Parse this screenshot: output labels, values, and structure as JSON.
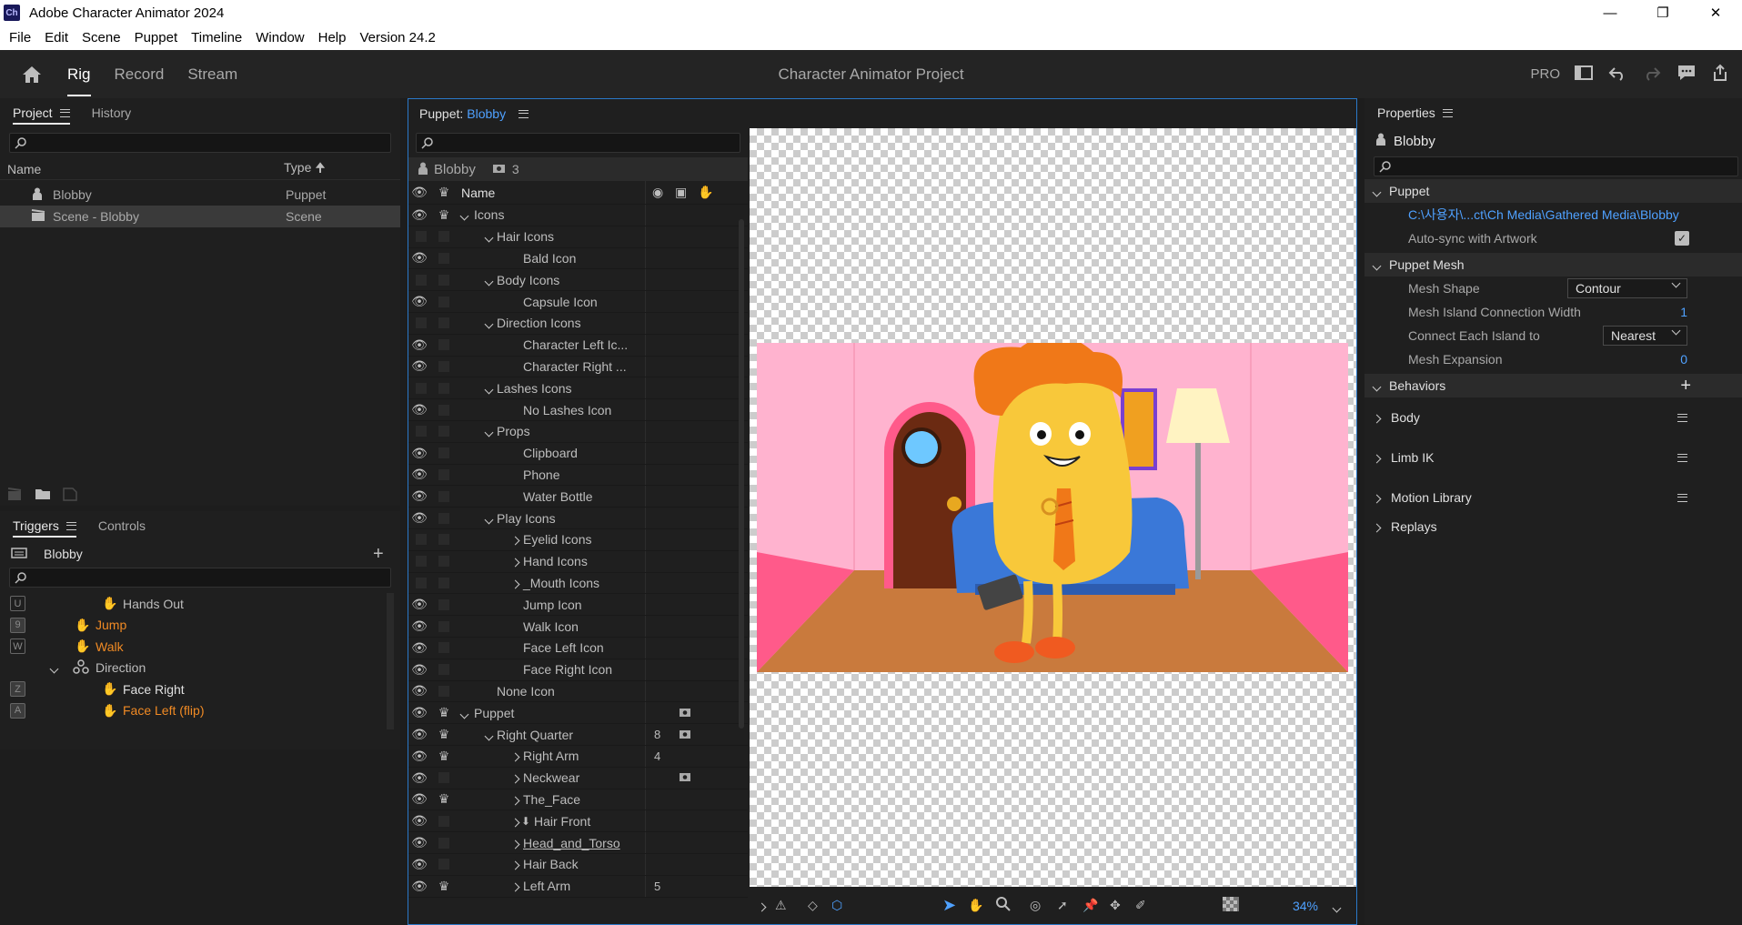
{
  "titlebar": {
    "app_icon": "Ch",
    "title": "Adobe Character Animator 2024"
  },
  "menubar": [
    "File",
    "Edit",
    "Scene",
    "Puppet",
    "Timeline",
    "Window",
    "Help",
    "Version 24.2"
  ],
  "workspace": {
    "tabs": [
      "Rig",
      "Record",
      "Stream"
    ],
    "active_tab": "Rig",
    "project_title": "Character Animator Project",
    "pro_label": "PRO"
  },
  "project": {
    "tabs": [
      "Project",
      "History"
    ],
    "col_name": "Name",
    "col_type": "Type",
    "rows": [
      {
        "name": "Blobby",
        "type": "Puppet"
      },
      {
        "name": "Scene - Blobby",
        "type": "Scene"
      }
    ]
  },
  "triggers": {
    "tabs": [
      "Triggers",
      "Controls"
    ],
    "puppet_name": "Blobby",
    "rows": [
      {
        "key": "U",
        "name": "Hands Out"
      },
      {
        "key": "9",
        "name": "Jump"
      },
      {
        "key": "W",
        "name": "Walk"
      },
      {
        "key": "",
        "name": "Direction"
      },
      {
        "key": "Z",
        "name": "Face Right"
      },
      {
        "key": "A",
        "name": "Face Left (flip)"
      }
    ]
  },
  "puppet": {
    "header_label": "Puppet:",
    "header_name": "Blobby",
    "layer_head_name": "Blobby",
    "layer_head_count": "3",
    "col_name": "Name",
    "layers": [
      {
        "name": "Icons"
      },
      {
        "name": "Hair Icons"
      },
      {
        "name": "Bald Icon"
      },
      {
        "name": "Body Icons"
      },
      {
        "name": "Capsule Icon"
      },
      {
        "name": "Direction Icons"
      },
      {
        "name": "Character Left Ic..."
      },
      {
        "name": "Character Right ..."
      },
      {
        "name": "Lashes Icons"
      },
      {
        "name": "No Lashes Icon"
      },
      {
        "name": "Props"
      },
      {
        "name": "Clipboard"
      },
      {
        "name": "Phone"
      },
      {
        "name": "Water Bottle"
      },
      {
        "name": "Play Icons"
      },
      {
        "name": "Eyelid Icons"
      },
      {
        "name": "Hand Icons"
      },
      {
        "name": "_Mouth Icons"
      },
      {
        "name": "Jump Icon"
      },
      {
        "name": "Walk Icon"
      },
      {
        "name": "Face Left Icon"
      },
      {
        "name": "Face Right Icon"
      },
      {
        "name": "None Icon"
      },
      {
        "name": "Puppet"
      },
      {
        "name": "Right Quarter",
        "count": "8"
      },
      {
        "name": "Right Arm",
        "count": "4"
      },
      {
        "name": "Neckwear"
      },
      {
        "name": "The_Face"
      },
      {
        "name": "Hair Front"
      },
      {
        "name": "Head_and_Torso"
      },
      {
        "name": "Hair Back"
      },
      {
        "name": "Left Arm",
        "count": "5"
      }
    ],
    "zoom": "34%"
  },
  "properties": {
    "tab": "Properties",
    "title": "Blobby",
    "section_puppet": "Puppet",
    "path": "C:\\사용자\\...ct\\Ch Media\\Gathered Media\\Blobby",
    "autosync_label": "Auto-sync with Artwork",
    "section_mesh": "Puppet Mesh",
    "mesh_shape_label": "Mesh Shape",
    "mesh_shape_value": "Contour",
    "island_width_label": "Mesh Island Connection Width",
    "island_width_value": "1",
    "connect_label": "Connect Each Island to",
    "connect_value": "Nearest",
    "expansion_label": "Mesh Expansion",
    "expansion_value": "0",
    "section_behaviors": "Behaviors",
    "behaviors": [
      "Body",
      "Limb IK",
      "Motion Library",
      "Replays"
    ]
  },
  "colors": {
    "accent": "#4fa1ff",
    "trigger": "#f08a24",
    "wall": "#ffb3cf",
    "floor": "#c97a3d"
  }
}
